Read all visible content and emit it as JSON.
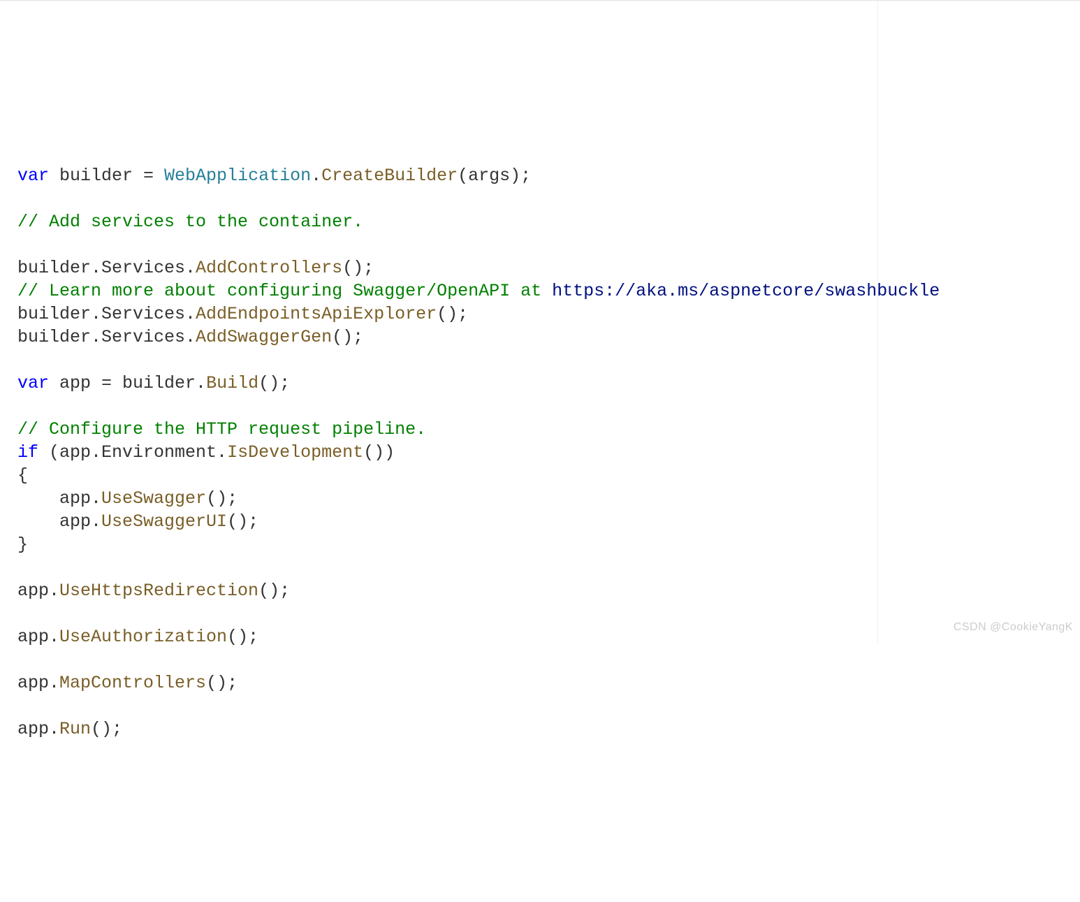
{
  "code": {
    "l1_var": "var",
    "l1_builder": " builder = ",
    "l1_type": "WebApplication",
    "l1_dot": ".",
    "l1_method": "CreateBuilder",
    "l1_end": "(args);",
    "l3_comment": "// Add services to the container.",
    "l5_pre": "builder.Services.",
    "l5_method": "AddControllers",
    "l5_end": "();",
    "l6_comment_pre": "// Learn more about configuring Swagger/OpenAPI at ",
    "l6_link": "https://aka.ms/aspnetcore/swashbuckle",
    "l7_pre": "builder.Services.",
    "l7_method": "AddEndpointsApiExplorer",
    "l7_end": "();",
    "l8_pre": "builder.Services.",
    "l8_method": "AddSwaggerGen",
    "l8_end": "();",
    "l10_var": "var",
    "l10_mid": " app = builder.",
    "l10_method": "Build",
    "l10_end": "();",
    "l12_comment": "// Configure the HTTP request pipeline.",
    "l13_if": "if",
    "l13_mid": " (app.Environment.",
    "l13_method": "IsDevelopment",
    "l13_end": "())",
    "l14_brace": "{",
    "l15_pre": "    app.",
    "l15_method": "UseSwagger",
    "l15_end": "();",
    "l16_pre": "    app.",
    "l16_method": "UseSwaggerUI",
    "l16_end": "();",
    "l17_brace": "}",
    "l19_pre": "app.",
    "l19_method": "UseHttpsRedirection",
    "l19_end": "();",
    "l21_pre": "app.",
    "l21_method": "UseAuthorization",
    "l21_end": "();",
    "l23_pre": "app.",
    "l23_method": "MapControllers",
    "l23_end": "();",
    "l25_pre": "app.",
    "l25_method": "Run",
    "l25_end": "();"
  },
  "watermark": "CSDN @CookieYangK"
}
